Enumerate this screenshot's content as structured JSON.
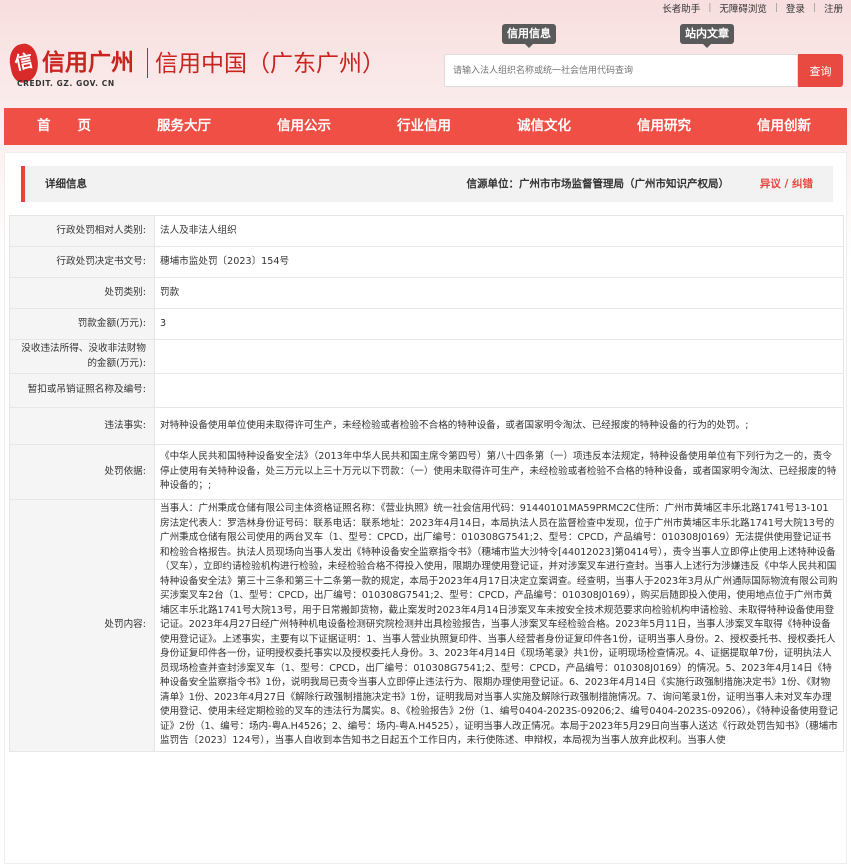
{
  "topbar": {
    "links": [
      "长者助手",
      "无障碍浏览",
      "登录",
      "注册"
    ]
  },
  "header": {
    "logo_mark": "信",
    "logo_text": "信用广州",
    "logo_sub": "CREDIT. GZ. GOV. CN",
    "site_title": "信用中国（广东广州）",
    "tab_info": "信用信息",
    "tab_search": "站内文章",
    "search_placeholder": "请输入法人组织名称或统一社会信用代码查询",
    "search_button": "查询"
  },
  "nav": [
    "首　　页",
    "服务大厅",
    "信用公示",
    "行业信用",
    "诚信文化",
    "信用研究",
    "信用创新"
  ],
  "detail": {
    "title": "详细信息",
    "source": "信源单位：广州市市场监督管理局（广州市知识产权局）",
    "action": "异议 / 纠错"
  },
  "rows": [
    {
      "label": "行政处罚相对人类别:",
      "value": "法人及非法人组织"
    },
    {
      "label": "行政处罚决定书文号:",
      "value": "穗埔市监处罚〔2023〕154号"
    },
    {
      "label": "处罚类别:",
      "value": "罚款"
    },
    {
      "label": "罚款金额(万元):",
      "value": "3"
    },
    {
      "label": "没收违法所得、没收非法财物的金额(万元):",
      "value": ""
    },
    {
      "label": "暂扣或吊销证照名称及编号:",
      "value": ""
    },
    {
      "label": "违法事实:",
      "value": "对特种设备使用单位使用未取得许可生产，未经检验或者检验不合格的特种设备，或者国家明令淘汰、已经报废的特种设备的行为的处罚。;"
    },
    {
      "label": "处罚依据:",
      "value": "《中华人民共和国特种设备安全法》（2013年中华人民共和国主席令第四号）第八十四条第（一）项违反本法规定，特种设备使用单位有下列行为之一的，责令停止使用有关特种设备，处三万元以上三十万元以下罚款：（一）使用未取得许可生产，未经检验或者检验不合格的特种设备，或者国家明令淘汰、已经报废的特种设备的；;"
    },
    {
      "label": "处罚内容:",
      "value": "当事人：广州秉成仓储有限公司主体资格证照名称：《营业执照》统一社会信用代码：91440101MA59PRMC2C住所：广州市黄埔区丰乐北路1741号13-101房法定代表人：罗浩林身份证号码：联系电话：联系地址：2023年4月14日，本局执法人员在监督检查中发现，位于广州市黄埔区丰乐北路1741号大院13号的广州秉成仓储有限公司使用的两台叉车（1、型号：CPCD，出厂编号：010308G7541;2、型号：CPCD，产品编号：010308J0169）无法提供使用登记证书和检验合格报告。执法人员现场向当事人发出《特种设备安全监察指令书》（穗埔市监大沙特令[44012023]第0414号），责令当事人立即停止使用上述特种设备（叉车），立即约请检验机构进行检验，未经检验合格不得投入使用，限期办理使用登记证，并对涉案叉车进行查封。当事人上述行为涉嫌违反《中华人民共和国特种设备安全法》第三十三条和第三十二条第一款的规定，本局于2023年4月17日决定立案调查。经查明，当事人于2023年3月从广州通际国际物流有限公司购买涉案叉车2台（1、型号：CPCD，出厂编号：010308G7541;2、型号：CPCD，产品编号：010308J0169），购买后随即投入使用，使用地点位于广州市黄埔区丰乐北路1741号大院13号，用于日常搬卸货物，截止案发时2023年4月14日涉案叉车未按安全技术规范要求向检验机构申请检验、未取得特种设备使用登记证。2023年4月27日经广州特种机电设备检测研究院检测并出具检验报告，当事人涉案叉车经检验合格。2023年5月11日，当事人涉案叉车取得《特种设备使用登记证》。上述事实，主要有以下证据证明：1、当事人营业执照复印件、当事人经营者身份证复印件各1份，证明当事人身份。2、授权委托书、授权委托人身份证复印件各一份，证明授权委托事实以及授权委托人身份。3、2023年4月14日《现场笔录》共1份，证明现场检查情况。4、证据提取单7份，证明执法人员现场检查并查封涉案叉车（1、型号：CPCD，出厂编号：010308G7541;2、型号：CPCD，产品编号：010308J0169）的情况。5、2023年4月14日《特种设备安全监察指令书》1份，说明我局已责令当事人立即停止违法行为、限期办理使用登记证。6、2023年4月14日《实施行政强制措施决定书》1份、《财物清单》1份、2023年4月27日《解除行政强制措施决定书》1份，证明我局对当事人实施及解除行政强制措施情况。7、询问笔录1份，证明当事人未对叉车办理使用登记、使用未经定期检验的叉车的违法行为属实。8、《检验报告》2份（1、编号0404-2023S-09206;2、编号0404-2023S-09206），《特种设备使用登记证》2份（1、编号：场内-粤A.H4526；2、编号：场内-粤A.H4525），证明当事人改正情况。本局于2023年5月29日向当事人送达《行政处罚告知书》（穗埔市监罚告〔2023〕124号），当事人自收到本告知书之日起五个工作日内，未行使陈述、申辩权，本局视为当事人放弃此权利。当事人使"
    }
  ]
}
